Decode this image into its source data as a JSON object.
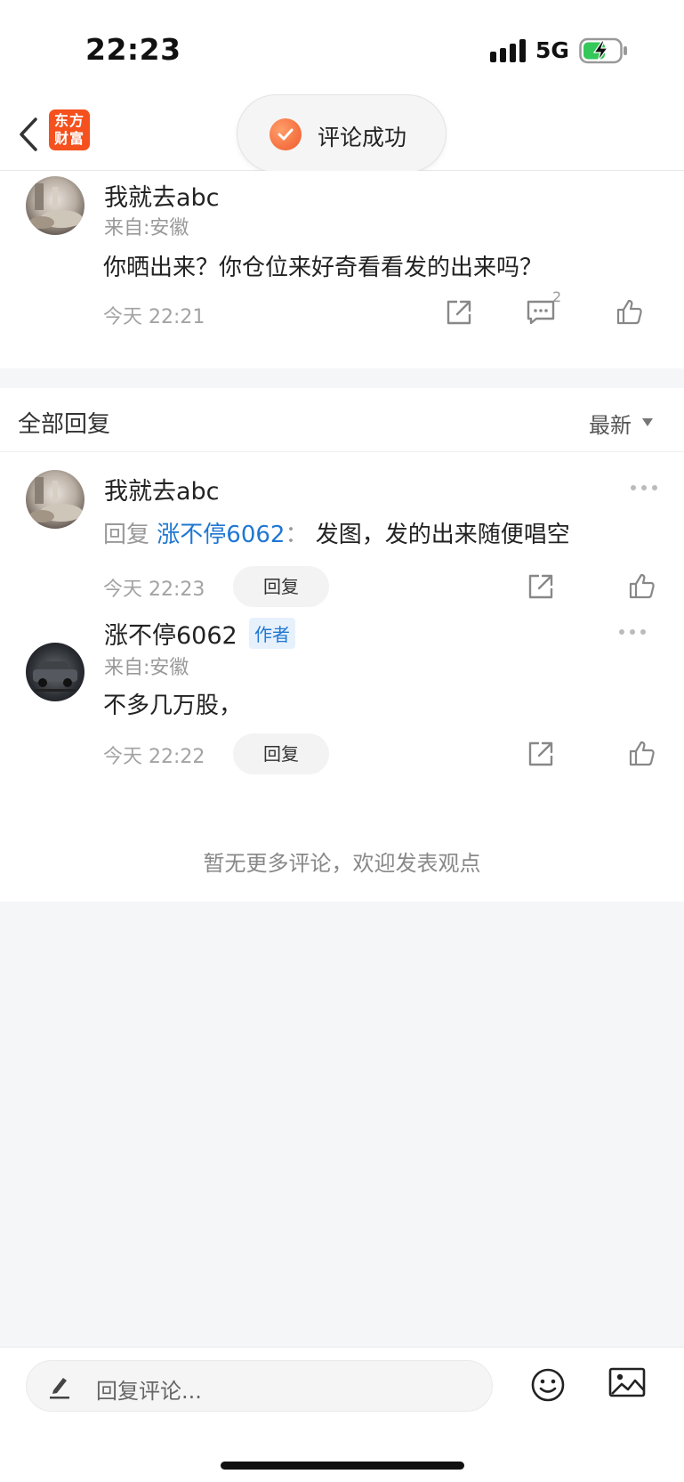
{
  "status": {
    "time": "22:23",
    "network": "5G"
  },
  "nav": {
    "logo_line1": "东方",
    "logo_line2": "财富",
    "toast": "评论成功"
  },
  "post": {
    "name": "我就去abc",
    "source": "来自:安徽",
    "content": "你晒出来？你仓位来好奇看看发的出来吗？",
    "time": "今天 22:21",
    "comment_count": "2"
  },
  "replies_header": {
    "title": "全部回复",
    "sort": "最新"
  },
  "replies": [
    {
      "name": "我就去abc",
      "prefix": "回复",
      "target": "涨不停6062",
      "colon": "：",
      "text": "发图，发的出来随便唱空",
      "time": "今天 22:23",
      "reply_label": "回复"
    },
    {
      "name": "涨不停6062",
      "tag": "作者",
      "source": "来自:安徽",
      "text": "不多几万股，",
      "time": "今天 22:22",
      "reply_label": "回复"
    }
  ],
  "footer_note": "暂无更多评论，欢迎发表观点",
  "bottom": {
    "placeholder": "回复评论..."
  },
  "colors": {
    "accent": "#1f77d2",
    "brand": "#f4511e",
    "toast_check": "#f0592b"
  }
}
